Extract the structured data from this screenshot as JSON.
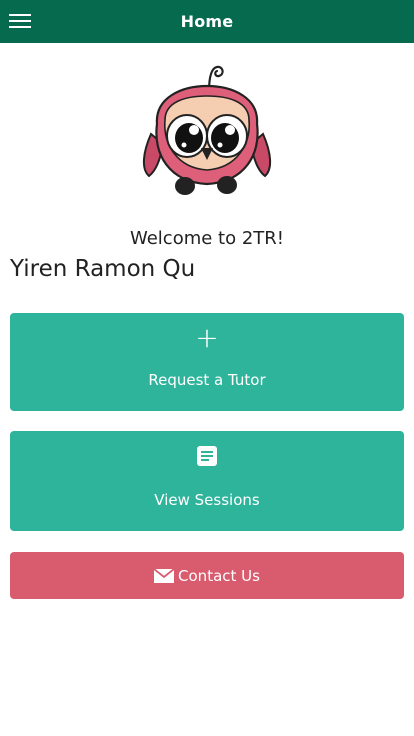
{
  "header": {
    "title": "Home",
    "background": "#066a4f"
  },
  "logo": {
    "icon": "owl-mascot"
  },
  "welcome_text": "Welcome to 2TR!",
  "user_name": "Yiren Ramon Qu",
  "actions": {
    "request_tutor": {
      "label": "Request a Tutor",
      "icon": "plus-icon",
      "color": "#2eb49b"
    },
    "view_sessions": {
      "label": "View Sessions",
      "icon": "document-icon",
      "color": "#2eb49b"
    },
    "contact_us": {
      "label": "Contact Us",
      "icon": "mail-icon",
      "color": "#d95b6e"
    }
  }
}
